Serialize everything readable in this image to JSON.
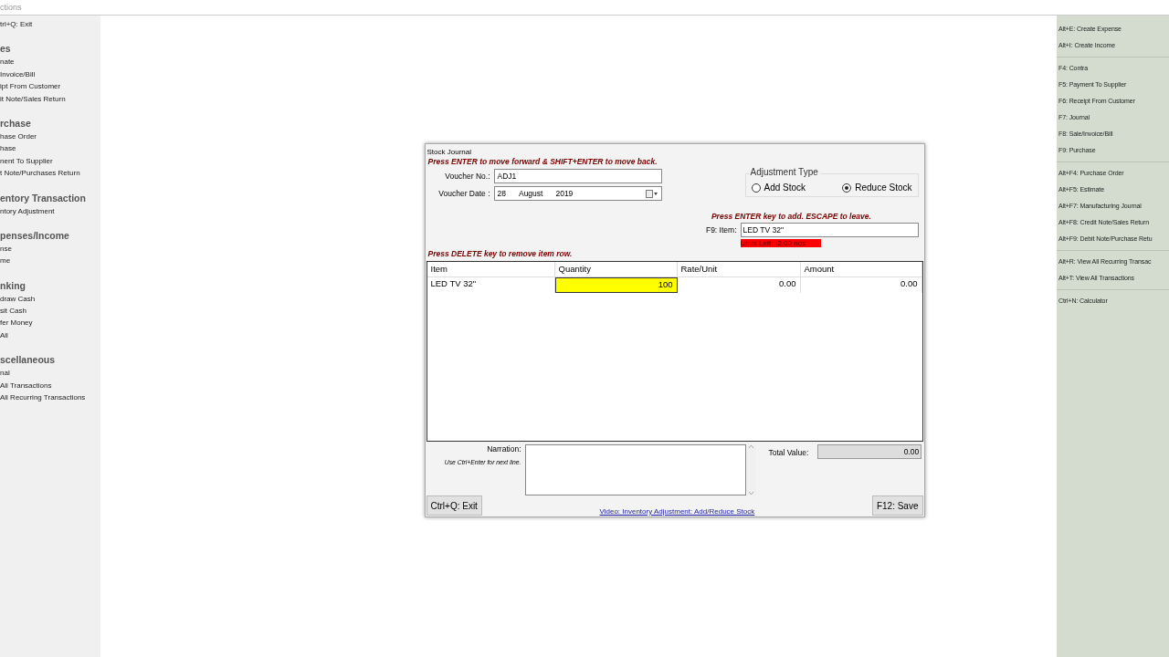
{
  "window": {
    "title": "ctions"
  },
  "left_panel": {
    "items": [
      "trl+Q: Exit"
    ],
    "sections": [
      {
        "heading": "es",
        "items": [
          "nate",
          "Invoice/Bill",
          "ipt From Customer",
          "it Note/Sales Return"
        ]
      },
      {
        "heading": "rchase",
        "items": [
          "hase Order",
          "hase",
          "nent To Supplier",
          "t Note/Purchases Return"
        ]
      },
      {
        "heading": "entory Transaction",
        "items": [
          "ntory Adjustment"
        ]
      },
      {
        "heading": "penses/Income",
        "items": [
          "nse",
          "me"
        ]
      },
      {
        "heading": "nking",
        "items": [
          "draw Cash",
          "sit Cash",
          "fer Money",
          "All"
        ]
      },
      {
        "heading": "scellaneous",
        "items": [
          "nal",
          "All Transactions",
          "All Recurring Transactions"
        ]
      }
    ]
  },
  "right_panel": {
    "groups": [
      [
        "Alt+E: Create Expense",
        "Alt+I: Create Income"
      ],
      [
        "F4: Contra",
        "F5: Payment To Supplier",
        "F6: Receipt From Customer",
        "F7: Journal",
        "F8: Sale/Invoice/Bill",
        "F9: Purchase"
      ],
      [
        "Alt+F4: Purchase Order",
        "Alt+F5: Estimate",
        "Alt+F7: Manufacturing Journal",
        "Alt+F8: Credit Note/Sales Return",
        "Alt+F9: Debit Note/Purchase Retu"
      ],
      [
        "Alt+R: View All Recurring Transac",
        "Alt+T: View All Transactions"
      ],
      [
        "Ctrl+N: Calculator"
      ]
    ]
  },
  "dialog": {
    "title": "Stock Journal",
    "hint_top": "Press ENTER to move forward & SHIFT+ENTER to move back.",
    "voucher_no": {
      "label": "Voucher No.:",
      "value": "ADJ1"
    },
    "voucher_date": {
      "label": "Voucher Date :",
      "day": "28",
      "month": "August",
      "year": "2019"
    },
    "adjustment_type": {
      "title": "Adjustment Type",
      "options": [
        {
          "label": "Add Stock",
          "selected": false
        },
        {
          "label": "Reduce Stock",
          "selected": true
        }
      ]
    },
    "item_hint": "Press ENTER key to add. ESCAPE to leave.",
    "item": {
      "label": "F9: Item:",
      "value": "LED TV 32\""
    },
    "units_left": "Units Left:  -2.00 nos",
    "hint_delete": "Press DELETE key to remove item row.",
    "table": {
      "columns": [
        "Item",
        "Quantity",
        "Rate/Unit",
        "Amount"
      ],
      "rows": [
        {
          "cells": [
            {
              "value": "LED TV 32\"",
              "selected": false
            },
            {
              "value": "100",
              "selected": true
            },
            {
              "value": "0.00",
              "selected": false
            },
            {
              "value": "0.00",
              "selected": false
            }
          ]
        }
      ]
    },
    "narration": {
      "label": "Narration:",
      "hint": "Use Ctrl+Enter for next line."
    },
    "total": {
      "label": "Total Value:",
      "value": "0.00"
    },
    "buttons": {
      "exit": "Ctrl+Q: Exit",
      "save": "F12: Save"
    },
    "link": "Video: Inventory Adjustment: Add/Reduce Stock"
  }
}
